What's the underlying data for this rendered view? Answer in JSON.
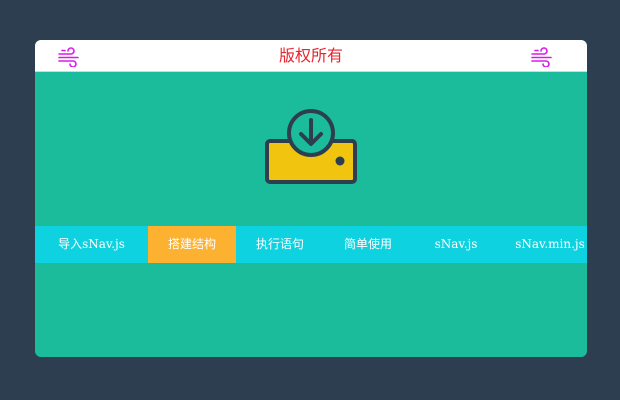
{
  "header": {
    "title": "版权所有",
    "left_icon": "wind-icon",
    "right_icon": "wind-icon",
    "icon_color": "#d81be8",
    "title_color": "#e8252c"
  },
  "hero": {
    "icon": "download-tray-icon",
    "tray_color": "#f1c40f",
    "stroke_color": "#2c3e50"
  },
  "tabs": [
    {
      "label": "导入sNav.js",
      "active": false
    },
    {
      "label": "搭建结构",
      "active": true
    },
    {
      "label": "执行语句",
      "active": false
    },
    {
      "label": "简单使用",
      "active": false
    },
    {
      "label": "sNav.js",
      "active": false
    },
    {
      "label": "sNav.min.js",
      "active": false
    }
  ],
  "colors": {
    "page_background": "#2c3e50",
    "card_background": "#1abc9c",
    "tabbar_background": "#0fd2e0",
    "active_tab": "#fdb131"
  }
}
